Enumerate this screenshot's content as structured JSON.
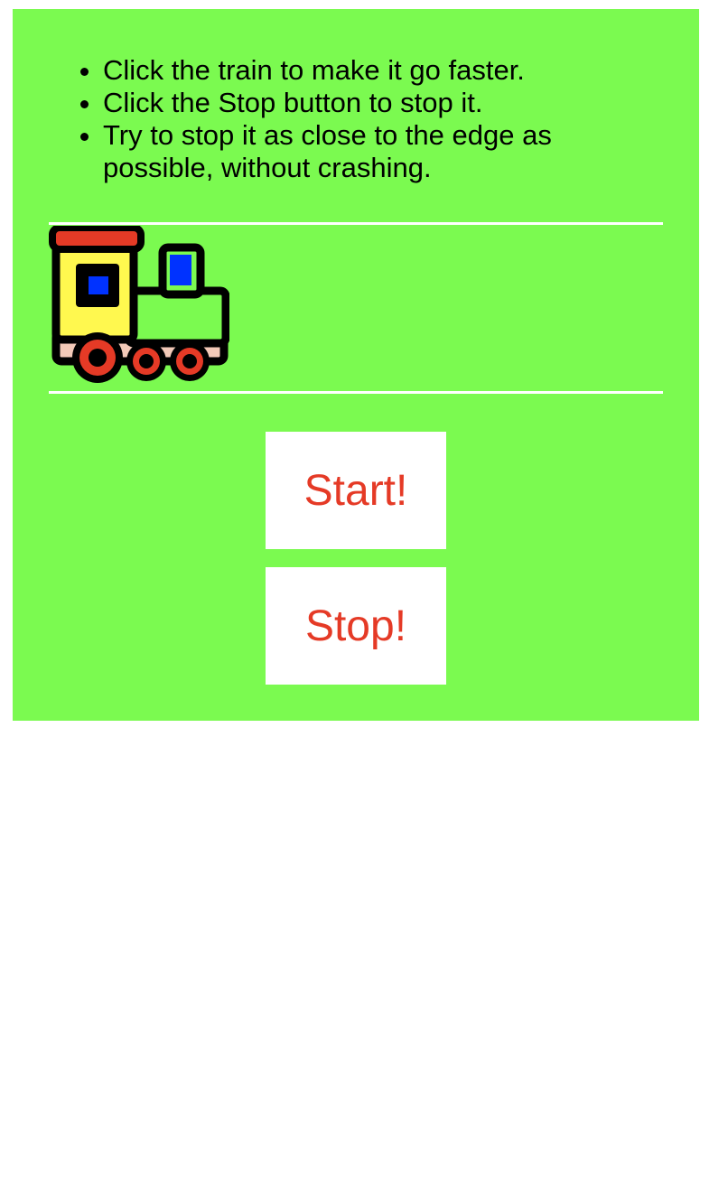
{
  "instructions": [
    "Click the train to make it go faster.",
    "Click the Stop button to stop it.",
    "Try to stop it as close to the edge as possible, without crashing."
  ],
  "train": {
    "icon": "train-icon"
  },
  "buttons": {
    "start_label": "Start!",
    "stop_label": "Stop!"
  },
  "colors": {
    "panel_background": "#7bfa50",
    "button_text": "#e53a26",
    "button_background": "#ffffff",
    "rail": "#ffffff"
  }
}
